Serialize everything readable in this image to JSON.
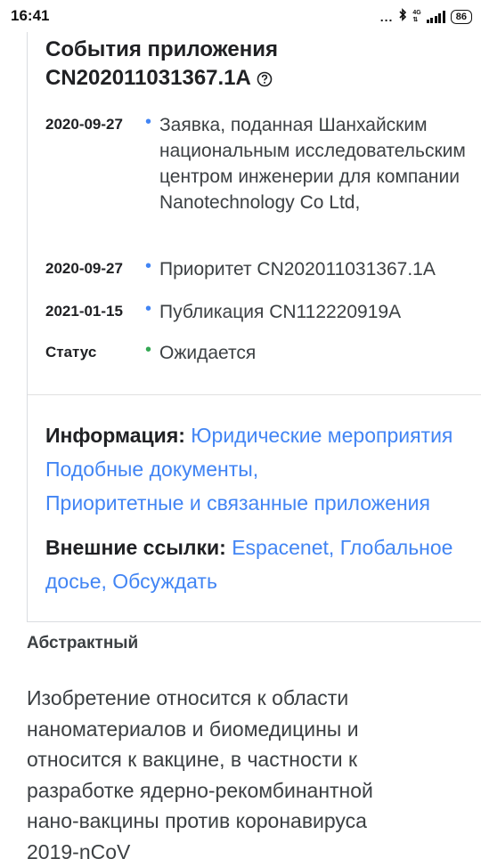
{
  "status_bar": {
    "time": "16:41",
    "more": "...",
    "network": "4G",
    "battery": "86"
  },
  "events": {
    "title": "События приложения CN202011031367.1A",
    "help_icon": "question-circle-icon",
    "items": [
      {
        "date": "2020-09-27",
        "text": "Заявка, поданная Шанхайским национальным исследовательским центром инженерии для компании Nanotechnology Co Ltd,",
        "bullet_color": "#4285f4"
      },
      {
        "date": "2020-09-27",
        "text": "Приоритет CN202011031367.1A",
        "bullet_color": "#4285f4"
      },
      {
        "date": "2021-01-15",
        "text": "Публикация CN112220919A",
        "bullet_color": "#4285f4"
      },
      {
        "date": "Статус",
        "text": "Ожидается",
        "bullet_color": "#34a853"
      }
    ]
  },
  "info": {
    "label": "Информация:",
    "links": [
      "Юридические мероприятия",
      "Подобные документы",
      "Приоритетные и связанные приложения"
    ]
  },
  "external": {
    "label": "Внешние ссылки:",
    "links": [
      "Espacenet",
      "Глобальное досье",
      "Обсуждать"
    ]
  },
  "abstract": {
    "heading": "Абстрактный",
    "text": "Изобретение относится к области наноматериалов и биомедицины и относится к вакцине, в частности к разработке ядерно-рекомбинантной нано-вакцины против коронавируса 2019-nCoV"
  },
  "colors": {
    "link": "#4285f4",
    "status_pending": "#34a853"
  }
}
